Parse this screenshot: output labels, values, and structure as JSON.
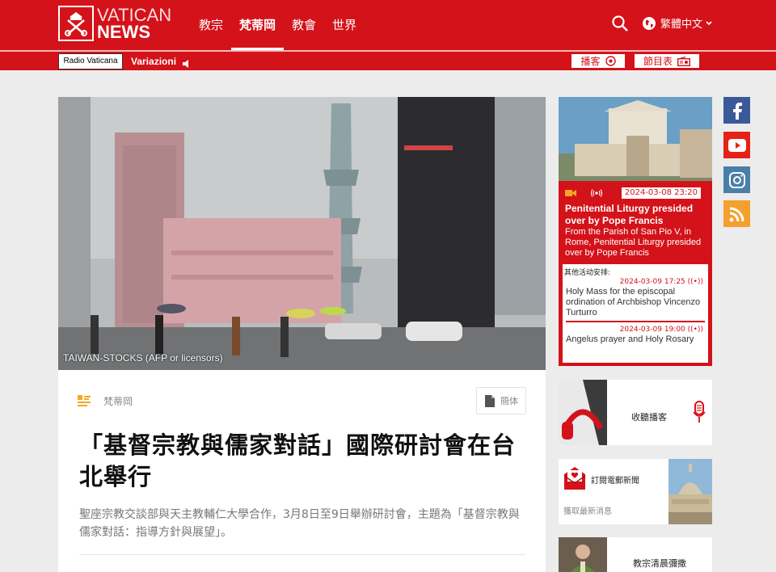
{
  "header": {
    "logo_line1": "VATICAN",
    "logo_line2": "NEWS",
    "nav": [
      {
        "label": "教宗",
        "active": false
      },
      {
        "label": "梵蒂岡",
        "active": true
      },
      {
        "label": "教會",
        "active": false
      },
      {
        "label": "世界",
        "active": false
      }
    ],
    "language": "繁體中文"
  },
  "radio": {
    "badge": "Radio Vaticana",
    "variations": "Variazioni",
    "podcast": "播客",
    "schedule": "節目表"
  },
  "article": {
    "image_caption": "TAIWAN-STOCKS  (AFP or licensors)",
    "category": "梵蒂岡",
    "simplified_button": "簡体",
    "title": "「基督宗教與儒家對話」國際研討會在台北舉行",
    "summary": "聖座宗教交談部與天主教輔仁大學合作，3月8日至9日舉辦研討會，主題為「基督宗教與儒家對話：指導方針與展望」。"
  },
  "event": {
    "date": "2024-03-08 23:20",
    "title": "Penitential Liturgy presided over by Pope Francis",
    "description": "From the Parish of San Pio V, in Rome, Penitential Liturgy presided over by Pope Francis",
    "more_label": "其他活动安排:",
    "more": [
      {
        "date": "2024-03-09 17:25",
        "title": "Holy Mass for the episcopal ordination of Archbishop Vincenzo Turturro"
      },
      {
        "date": "2024-03-09 19:00",
        "title": "Angelus prayer and Holy Rosary"
      }
    ]
  },
  "side": {
    "podcast_label": "收聽播客",
    "newsletter_title": "訂閱電郵新聞",
    "newsletter_sub": "獲取最新消息",
    "mass_label": "教宗清晨彌撒"
  },
  "colors": {
    "brand_red": "#d4121a",
    "facebook": "#3b5998",
    "youtube": "#e62117",
    "instagram": "#4a7fa8",
    "rss": "#f59f2e"
  }
}
